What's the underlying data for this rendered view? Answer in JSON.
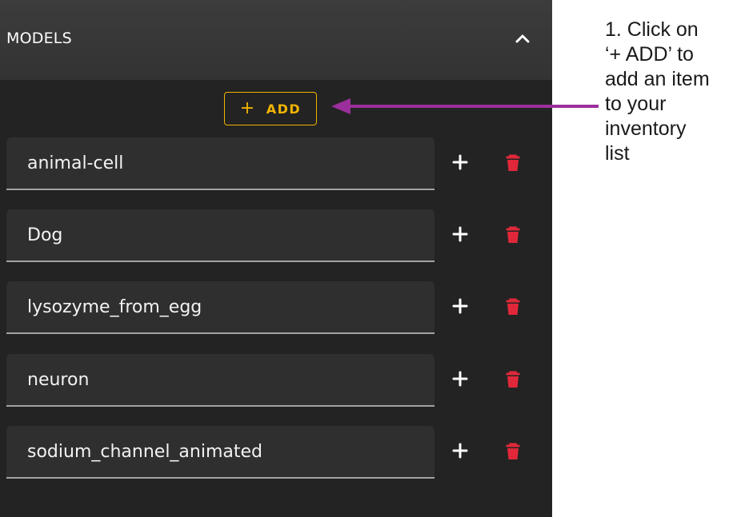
{
  "panel": {
    "title": "MODELS",
    "collapse_icon": "chevron-up-icon"
  },
  "add_button": {
    "plus": "+",
    "label": "ADD",
    "color": "#f0b400"
  },
  "models": [
    {
      "name": "animal-cell"
    },
    {
      "name": "Dog"
    },
    {
      "name": "lysozyme_from_egg"
    },
    {
      "name": "neuron"
    },
    {
      "name": "sodium_channel_animated"
    }
  ],
  "row_actions": {
    "add_icon": "plus-icon",
    "delete_icon": "trash-icon",
    "delete_color": "#e0283a"
  },
  "annotation": {
    "lines": [
      "1. Click on",
      "‘+ ADD’ to",
      "add an item",
      "to your",
      "inventory",
      "list"
    ],
    "arrow_color": "#9b2f9b"
  }
}
